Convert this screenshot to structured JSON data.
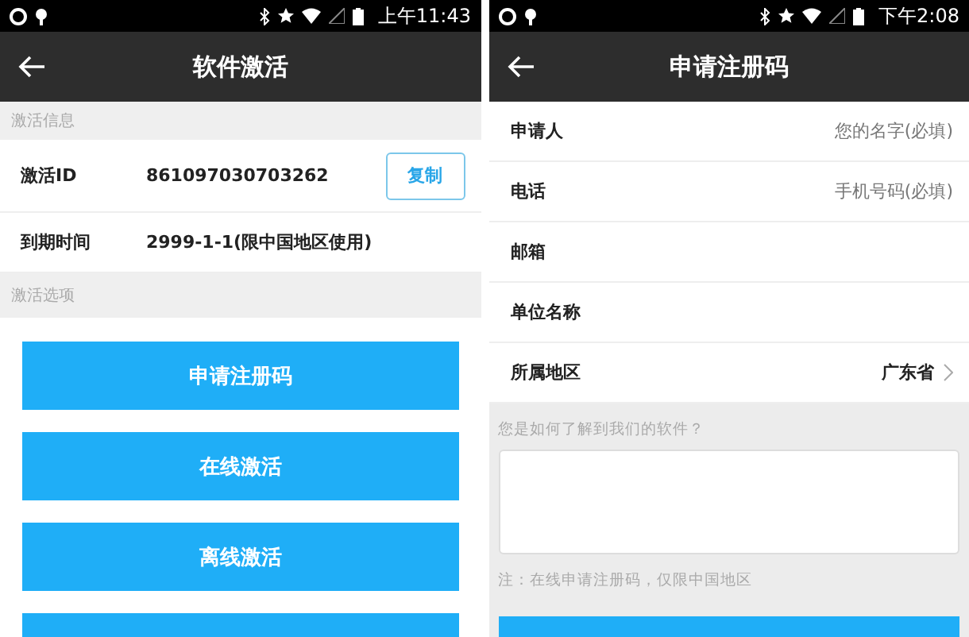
{
  "screens": [
    {
      "kind": "activation",
      "status_bar": {
        "time": "上午11:43"
      },
      "title": "软件激活",
      "sections": [
        {
          "header": "激活信息",
          "rows": [
            {
              "label": "激活ID",
              "value": "861097030703262",
              "action": "复制"
            },
            {
              "label": "到期时间",
              "value": "2999-1-1(限中国地区使用)"
            }
          ]
        },
        {
          "header": "激活选项"
        }
      ],
      "options": [
        {
          "label": "申请注册码"
        },
        {
          "label": "在线激活"
        },
        {
          "label": "离线激活"
        }
      ],
      "more_option_cut_off": true
    },
    {
      "kind": "register",
      "status_bar": {
        "time": "下午2:08"
      },
      "title": "申请注册码",
      "fields": [
        {
          "label": "申请人",
          "placeholder": "您的名字(必填)",
          "kind": "input"
        },
        {
          "label": "电话",
          "placeholder": "手机号码(必填)",
          "kind": "input"
        },
        {
          "label": "邮箱",
          "kind": "input"
        },
        {
          "label": "单位名称",
          "kind": "input"
        },
        {
          "label": "所属地区",
          "value": "广东省",
          "kind": "picker"
        }
      ],
      "question": "您是如何了解到我们的软件？",
      "note": "注：在线申请注册码，仅限中国地区",
      "submit_cut_off": true
    }
  ]
}
